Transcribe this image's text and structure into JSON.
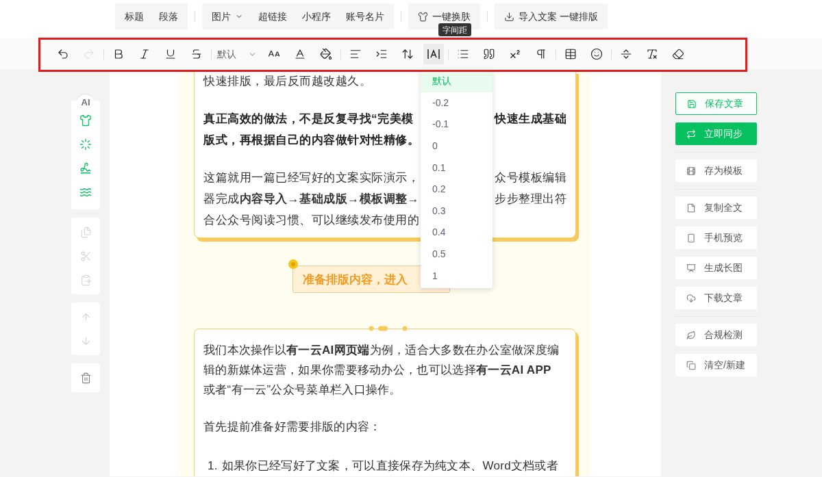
{
  "top_toolbar": {
    "groups": [
      {
        "items": [
          {
            "label": "标题",
            "dropdown": false
          },
          {
            "label": "段落",
            "dropdown": false
          }
        ]
      },
      {
        "items": [
          {
            "label": "图片",
            "dropdown": true
          },
          {
            "label": "超链接",
            "dropdown": false
          },
          {
            "label": "小程序",
            "dropdown": false
          },
          {
            "label": "账号名片",
            "dropdown": false
          }
        ]
      },
      {
        "items": [
          {
            "label": "一键换肤",
            "dropdown": false
          }
        ]
      },
      {
        "items": [
          {
            "label": "导入文案 一键排版",
            "dropdown": false
          }
        ]
      }
    ]
  },
  "format_toolbar": {
    "groups": [
      [
        {
          "kind": "icon",
          "disabled": false,
          "selected": false
        },
        {
          "kind": "icon",
          "disabled": true,
          "selected": false
        }
      ],
      [
        {
          "kind": "icon",
          "disabled": false,
          "selected": false
        },
        {
          "kind": "icon",
          "disabled": false,
          "selected": false
        },
        {
          "kind": "icon",
          "disabled": false,
          "selected": false
        },
        {
          "kind": "icon",
          "disabled": false,
          "selected": false
        }
      ],
      [
        {
          "kind": "select",
          "value": "默认"
        },
        {
          "kind": "icon",
          "disabled": false,
          "selected": false
        },
        {
          "kind": "icon",
          "disabled": false,
          "selected": false
        },
        {
          "kind": "icon",
          "disabled": false,
          "selected": false
        }
      ],
      [
        {
          "kind": "icon",
          "disabled": false,
          "selected": false
        },
        {
          "kind": "icon",
          "disabled": false,
          "selected": false
        },
        {
          "kind": "icon",
          "disabled": false,
          "selected": false
        },
        {
          "kind": "icon",
          "disabled": false,
          "selected": true
        }
      ],
      [
        {
          "kind": "icon",
          "disabled": false,
          "selected": false
        },
        {
          "kind": "icon",
          "disabled": false,
          "selected": false
        },
        {
          "kind": "icon",
          "disabled": false,
          "selected": false
        },
        {
          "kind": "icon",
          "disabled": false,
          "selected": false
        }
      ],
      [
        {
          "kind": "icon",
          "disabled": false,
          "selected": false
        },
        {
          "kind": "icon",
          "disabled": false,
          "selected": false
        }
      ],
      [
        {
          "kind": "icon",
          "disabled": false,
          "selected": false
        },
        {
          "kind": "icon",
          "disabled": false,
          "selected": false
        },
        {
          "kind": "icon",
          "disabled": false,
          "selected": false
        }
      ]
    ]
  },
  "tooltip": "字间距",
  "letter_spacing_menu": [
    {
      "label": "默认",
      "selected": true
    },
    {
      "label": "-0.2",
      "selected": false
    },
    {
      "label": "-0.1",
      "selected": false
    },
    {
      "label": "0",
      "selected": false
    },
    {
      "label": "0.1",
      "selected": false
    },
    {
      "label": "0.2",
      "selected": false
    },
    {
      "label": "0.3",
      "selected": false
    },
    {
      "label": "0.4",
      "selected": false
    },
    {
      "label": "0.5",
      "selected": false
    },
    {
      "label": "1",
      "selected": false
    }
  ],
  "left_sidebar": {
    "ai_badge": "AI",
    "clip_tools": [
      {
        "disabled": true
      },
      {
        "disabled": true
      },
      {
        "disabled": true
      }
    ],
    "move_tools": [
      {
        "disabled": true
      },
      {
        "disabled": true
      }
    ],
    "delete_tool": {
      "disabled": false
    }
  },
  "article": {
    "card_1": {
      "paragraphs": [
        {
          "bold": false,
          "lines": [
            {
              "left": "快速排版，最后反而越改越久。"
            }
          ]
        },
        {
          "bold": true,
          "lines": [
            {
              "left": "真正高效的做法，不是反复寻找“完美模",
              "right": "快速生成基础"
            },
            {
              "left": "版式，再根据自己的内容做针对性精修。"
            }
          ]
        },
        {
          "bold": false,
          "lines": [
            {
              "left": "这篇就用一篇已经写好的文案实际演示，",
              "right": "众号模板编辑"
            },
            {
              "left": "器完成**内容导入→基础成版→模板调整→**",
              "right": "步步整理出符"
            },
            {
              "left": "合公众号阅读习惯、可以继续发布使用的"
            }
          ]
        }
      ]
    },
    "banner": "准备排版内容，进入",
    "card_2": {
      "paragraphs": [
        {
          "lines": [
            "我们本次操作以**有一云AI网页端**为例，适合大多数在办公室做深度编",
            "辑的新媒体运营，如果你需要移动办公，也可以选择**有一云AI APP**",
            "或者“有一云”公众号菜单栏入口操作。"
          ]
        },
        {
          "lines": [
            "首先提前准备好需要排版的内容："
          ]
        }
      ],
      "list_items": [
        {
          "number": "1.",
          "text": "如果你已经写好了文案，可以直接保存为纯文本、Word文档或者"
        }
      ]
    }
  },
  "right_actions": {
    "groups": [
      [
        {
          "label": "保存文章",
          "kind": "outline"
        },
        {
          "label": "立即同步",
          "kind": "primary"
        }
      ],
      [
        {
          "label": "存为模板",
          "kind": "plain"
        }
      ],
      [
        {
          "label": "复制全文",
          "kind": "plain"
        },
        {
          "label": "手机预览",
          "kind": "plain"
        },
        {
          "label": "生成长图",
          "kind": "plain"
        },
        {
          "label": "下载文章",
          "kind": "plain"
        }
      ],
      [
        {
          "label": "合规检测",
          "kind": "plain"
        },
        {
          "label": "清空/新建",
          "kind": "plain"
        }
      ]
    ]
  }
}
